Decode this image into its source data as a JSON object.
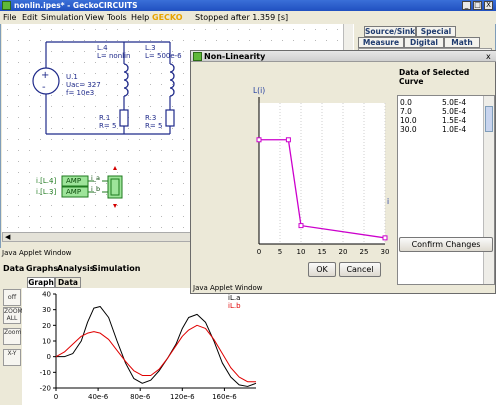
{
  "main_window": {
    "title": "nonlin.ipes* - GeckoCIRCUITS",
    "menu": [
      "File",
      "Edit",
      "Simulation",
      "View",
      "Tools",
      "Help"
    ],
    "logo_text": "GECKO",
    "status": "Stopped after  1.359 [s]",
    "window_buttons": [
      "_",
      "□",
      "X"
    ]
  },
  "right_tabs": {
    "row1": [
      "Source/Sink",
      "Special"
    ],
    "row2": [
      "Measure",
      "Digital",
      "Math"
    ]
  },
  "circuit": {
    "source_label_1": "U.1",
    "source_label_2": "Uac= 327",
    "source_label_3": "f= 10e3",
    "inductor1_name": "L.4",
    "inductor1_value": "L= nonlin",
    "inductor2_name": "L.3",
    "inductor2_value": "L= 500e-6",
    "resistor1_name": "R.1",
    "resistor1_value": "R= 5",
    "resistor2_name": "R.3",
    "resistor2_value": "R= 5",
    "meas1_label": "i.[L.4]",
    "meas2_label": "i.[L.3]",
    "amp_label": "AMP",
    "out1": "i_a",
    "out2": "i_b"
  },
  "applet_strip_label": "Java Applet Window",
  "scope": {
    "menu": [
      "Data",
      "Graphs",
      "Analysis",
      "Simulation"
    ],
    "tabs": [
      "Graph",
      "Data"
    ],
    "side_buttons": [
      "off",
      "ZOOM ALL",
      "Zoom",
      "X-Y"
    ],
    "legend": [
      {
        "name": "iL.a",
        "color": "#000000"
      },
      {
        "name": "iL.b",
        "color": "#e00000"
      }
    ]
  },
  "dialog": {
    "title": "Non-Linearity",
    "close": "x",
    "curve_title": "Data of Selected Curve",
    "table": [
      [
        "0.0",
        "5.0E-4"
      ],
      [
        "7.0",
        "5.0E-4"
      ],
      [
        "10.0",
        "1.5E-4"
      ],
      [
        "30.0",
        "1.0E-4"
      ]
    ],
    "confirm_label": "Confirm Changes",
    "ok_label": "OK",
    "cancel_label": "Cancel",
    "footer": "Java Applet Window"
  },
  "chart_data": [
    {
      "type": "line",
      "ylabel": "L(i)",
      "xlabel": "i",
      "x_ticks": [
        "0",
        "5",
        "10",
        "15",
        "20",
        "25",
        "30"
      ],
      "y_ticks": [
        "100e-6",
        "200e-6",
        "300e-6",
        "400e-6",
        "500e-6",
        "600e-6"
      ],
      "xlim": [
        0,
        30
      ],
      "ylim": [
        7.5e-05,
        0.00065
      ],
      "series": [
        {
          "x": [
            0,
            7,
            10,
            30
          ],
          "y": [
            0.0005,
            0.0005,
            0.00015,
            0.0001
          ],
          "color": "#cc00cc"
        }
      ]
    },
    {
      "type": "line",
      "x_ticks": [
        "0",
        "40e-6",
        "80e-6",
        "120e-6",
        "160e-6"
      ],
      "y_ticks": [
        "-20",
        "-10",
        "0",
        "10",
        "20",
        "30",
        "40"
      ],
      "xlim": [
        0,
        0.00019
      ],
      "ylim": [
        -20,
        40
      ],
      "series": [
        {
          "name": "iL.a",
          "color": "#000000",
          "x": [
            0,
            8e-06,
            1.6e-05,
            2.4e-05,
            3e-05,
            3.6e-05,
            4.2e-05,
            5e-05,
            5.8e-05,
            6.6e-05,
            7.4e-05,
            8.2e-05,
            9e-05,
            9.8e-05,
            0.000106,
            0.000114,
            0.00012,
            0.000126,
            0.000134,
            0.000142,
            0.00015,
            0.000158,
            0.000166,
            0.000174,
            0.000182,
            0.00019
          ],
          "y": [
            0,
            0,
            2,
            10,
            22,
            31,
            32,
            25,
            10,
            -4,
            -14,
            -17,
            -15,
            -9,
            -1,
            8,
            18,
            25,
            27,
            22,
            10,
            -4,
            -13,
            -18,
            -19,
            -17
          ]
        },
        {
          "name": "iL.b",
          "color": "#e00000",
          "x": [
            0,
            8e-06,
            1.6e-05,
            2.4e-05,
            3e-05,
            3.6e-05,
            4.2e-05,
            5e-05,
            5.8e-05,
            6.6e-05,
            7.4e-05,
            8.2e-05,
            9e-05,
            9.8e-05,
            0.000106,
            0.000114,
            0.00012,
            0.000126,
            0.000134,
            0.000142,
            0.00015,
            0.000158,
            0.000166,
            0.000174,
            0.000182,
            0.00019
          ],
          "y": [
            0,
            3,
            8,
            13,
            15,
            16,
            15,
            11,
            4,
            -3,
            -9,
            -12,
            -12,
            -8,
            -1,
            7,
            13,
            17,
            20,
            18,
            11,
            2,
            -7,
            -13,
            -16,
            -16
          ]
        }
      ]
    }
  ]
}
